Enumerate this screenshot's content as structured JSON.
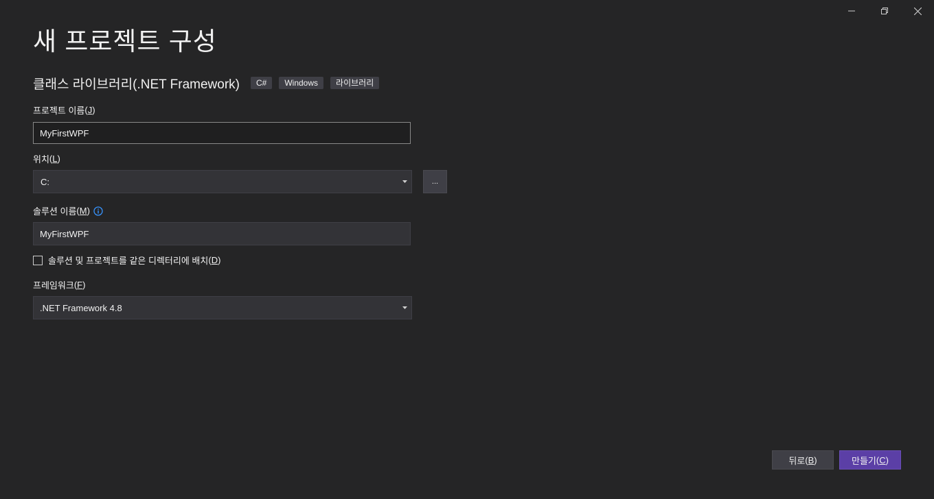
{
  "window_controls": {
    "minimize": "minimize-icon",
    "restore": "restore-icon",
    "close": "close-icon"
  },
  "page_title": "새 프로젝트 구성",
  "template": {
    "name": "클래스 라이브러리(.NET Framework)",
    "tags": [
      "C#",
      "Windows",
      "라이브러리"
    ]
  },
  "project_name": {
    "label": "프로젝트 이름",
    "accel_open": "(",
    "accel_key": "J",
    "accel_close": ")",
    "value": "MyFirstWPF"
  },
  "location": {
    "label": "위치",
    "accel_open": "(",
    "accel_key": "L",
    "accel_close": ")",
    "value": "C:",
    "browse_label": "..."
  },
  "solution_name": {
    "label": "솔루션 이름",
    "accel_open": "(",
    "accel_key": "M",
    "accel_close": ")",
    "value": "MyFirstWPF",
    "info_icon": "info-icon"
  },
  "same_directory": {
    "label": "솔루션 및 프로젝트를 같은 디렉터리에 배치",
    "accel_open": "(",
    "accel_key": "D",
    "accel_close": ")",
    "checked": false
  },
  "framework": {
    "label": "프레임워크",
    "accel_open": "(",
    "accel_key": "F",
    "accel_close": ")",
    "value": ".NET Framework 4.8"
  },
  "buttons": {
    "back": "뒤로",
    "back_accel": "B",
    "create": "만들기",
    "create_accel": "C"
  },
  "colors": {
    "background": "#252526",
    "input": "#333337",
    "accent": "#5b3fa6",
    "info": "#3794ff"
  }
}
